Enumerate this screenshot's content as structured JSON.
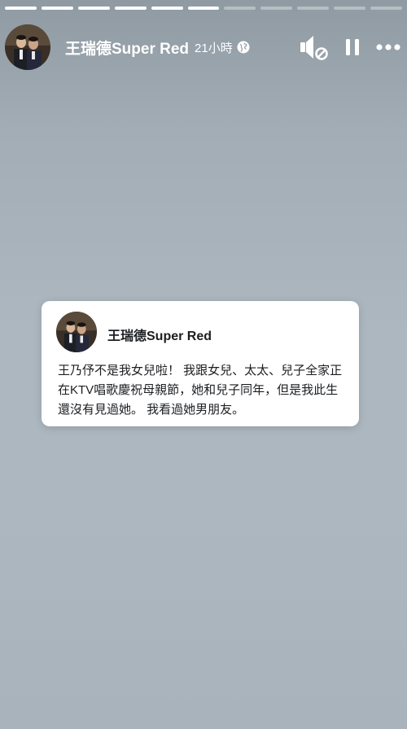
{
  "story": {
    "segments_total": 11,
    "segments_done": 6
  },
  "header": {
    "name": "王瑞德Super Red",
    "time": "21小時",
    "audience_icon": "globe-icon",
    "mute_icon": "speaker-muted-icon",
    "pause_icon": "pause-icon",
    "more_icon": "more-icon"
  },
  "post": {
    "author": "王瑞德Super Red",
    "text": "王乃伃不是我女兒啦！ 我跟女兒、太太、兒子全家正在KTV唱歌慶祝母親節，她和兒子同年，但是我此生還沒有見過她。 我看過她男朋友。"
  },
  "colors": {
    "background_top": "#8f9aa3",
    "background_mid": "#adb7bf",
    "card_bg": "#ffffff",
    "text_dark": "#1c1e21"
  }
}
